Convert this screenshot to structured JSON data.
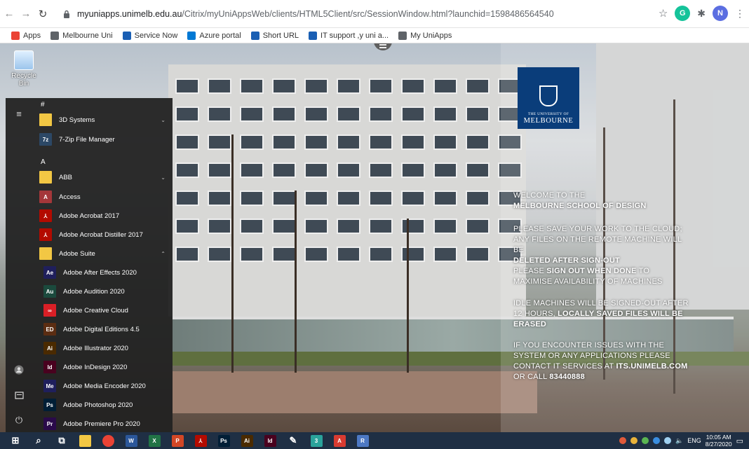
{
  "browser": {
    "url_host": "myuniapps.unimelb.edu.au",
    "url_path": "/Citrix/myUniAppsWeb/clients/HTML5Client/src/SessionWindow.html?launchid=1598486564540",
    "profile_initial": "N",
    "extension_initial": "G"
  },
  "bookmarks": [
    {
      "label": "Apps",
      "icon": "grid-icon",
      "color": "#ea4335"
    },
    {
      "label": "Melbourne Uni",
      "icon": "folder-icon",
      "color": "#5f6368"
    },
    {
      "label": "Service Now",
      "icon": "servicenow-icon",
      "color": "#1a5fb4"
    },
    {
      "label": "Azure portal",
      "icon": "azure-icon",
      "color": "#0078d4"
    },
    {
      "label": "Short URL",
      "icon": "shorturl-icon",
      "color": "#1a5fb4"
    },
    {
      "label": "IT support ,y uni a...",
      "icon": "itsupport-icon",
      "color": "#1a5fb4"
    },
    {
      "label": "My UniApps",
      "icon": "globe-icon",
      "color": "#5f6368"
    }
  ],
  "desktop": {
    "recycle_bin_label": "Recycle Bin"
  },
  "logo": {
    "top_line": "THE UNIVERSITY OF",
    "name": "MELBOURNE",
    "color": "#0a3d7a"
  },
  "messages": {
    "m1a": "WELCOME TO THE",
    "m1b": "MELBOURNE SCHOOL OF DESIGN",
    "m2a": "PLEASE SAVE YOUR WORK TO THE CLOUD; ANY FILES ON THE REMOTE MACHINE WILL BE",
    "m2b": "DELETED AFTER SIGN-OUT",
    "m3a": "PLEASE",
    "m3b": "SIGN OUT WHEN DONE",
    "m3c": "TO MAXIMISE AVAILABILITY OF MACHINES",
    "m4a": "IDLE MACHINES WILL BE SIGNED-OUT AFTER 12 HOURS,",
    "m4b": "LOCALLY SAVED FILES WILL BE ERASED",
    "m5a": "IF YOU ENCOUNTER ISSUES WITH THE SYSTEM OR ANY APPLICATIONS PLEASE CONTACT IT SERVICES AT",
    "m5b": "ITS.UNIMELB.COM",
    "m5c": "OR CALL",
    "m5d": "83440888"
  },
  "start_menu": {
    "letters": {
      "hash": "#",
      "a": "A"
    },
    "items": [
      {
        "label": "3D Systems",
        "icon": "folder-icon",
        "glyph": "",
        "color": "#f2c744",
        "chevron": "down"
      },
      {
        "label": "7-Zip File Manager",
        "icon": "7zip-icon",
        "glyph": "7z",
        "color": "#2c4866",
        "chevron": ""
      },
      {
        "label": "ABB",
        "icon": "folder-icon",
        "glyph": "",
        "color": "#f2c744",
        "chevron": "down"
      },
      {
        "label": "Access",
        "icon": "access-icon",
        "glyph": "A",
        "color": "#a4373a",
        "chevron": ""
      },
      {
        "label": "Adobe Acrobat 2017",
        "icon": "acrobat-icon",
        "glyph": "⅄",
        "color": "#b30b00",
        "chevron": ""
      },
      {
        "label": "Adobe Acrobat Distiller 2017",
        "icon": "distiller-icon",
        "glyph": "⅄",
        "color": "#b30b00",
        "chevron": ""
      },
      {
        "label": "Adobe Suite",
        "icon": "folder-icon",
        "glyph": "",
        "color": "#f2c744",
        "chevron": "up"
      }
    ],
    "sub_items": [
      {
        "label": "Adobe After Effects 2020",
        "icon": "after-effects-icon",
        "glyph": "Ae",
        "color": "#1f1f5c"
      },
      {
        "label": "Adobe Audition 2020",
        "icon": "audition-icon",
        "glyph": "Au",
        "color": "#1b4a3d"
      },
      {
        "label": "Adobe Creative Cloud",
        "icon": "creative-cloud-icon",
        "glyph": "∞",
        "color": "#da1f26"
      },
      {
        "label": "Adobe Digital Editions 4.5",
        "icon": "digital-editions-icon",
        "glyph": "ED",
        "color": "#5b2d12"
      },
      {
        "label": "Adobe Illustrator 2020",
        "icon": "illustrator-icon",
        "glyph": "Ai",
        "color": "#4a2a00"
      },
      {
        "label": "Adobe InDesign 2020",
        "icon": "indesign-icon",
        "glyph": "Id",
        "color": "#49021f"
      },
      {
        "label": "Adobe Media Encoder 2020",
        "icon": "media-encoder-icon",
        "glyph": "Me",
        "color": "#1f1f5c"
      },
      {
        "label": "Adobe Photoshop 2020",
        "icon": "photoshop-icon",
        "glyph": "Ps",
        "color": "#001e36"
      },
      {
        "label": "Adobe Premiere Pro 2020",
        "icon": "premiere-icon",
        "glyph": "Pr",
        "color": "#2a0a4a"
      }
    ]
  },
  "taskbar": {
    "apps": [
      {
        "name": "start-icon",
        "glyph": "⊞",
        "color": "#1f2f44"
      },
      {
        "name": "search-icon",
        "glyph": "⌕",
        "color": "#1f2f44"
      },
      {
        "name": "task-view-icon",
        "glyph": "⧉",
        "color": "#1f2f44"
      },
      {
        "name": "file-explorer-icon",
        "glyph": "",
        "color": "#f2c744"
      },
      {
        "name": "chrome-icon",
        "glyph": "",
        "color": "#ea4335"
      },
      {
        "name": "word-icon",
        "glyph": "W",
        "color": "#2b579a"
      },
      {
        "name": "excel-icon",
        "glyph": "X",
        "color": "#217346"
      },
      {
        "name": "powerpoint-icon",
        "glyph": "P",
        "color": "#d24726"
      },
      {
        "name": "acrobat-icon",
        "glyph": "⅄",
        "color": "#b30b00"
      },
      {
        "name": "photoshop-icon",
        "glyph": "Ps",
        "color": "#001e36"
      },
      {
        "name": "illustrator-icon",
        "glyph": "Ai",
        "color": "#4a2a00"
      },
      {
        "name": "indesign-icon",
        "glyph": "Id",
        "color": "#49021f"
      },
      {
        "name": "inkscape-icon",
        "glyph": "✎",
        "color": "#1f2f44"
      },
      {
        "name": "app3-icon",
        "glyph": "3",
        "color": "#2aa39b"
      },
      {
        "name": "autodesk-icon",
        "glyph": "A",
        "color": "#d83b31"
      },
      {
        "name": "rstudio-icon",
        "glyph": "R",
        "color": "#4d79c4"
      }
    ],
    "language": "ENG",
    "time": "10:05 AM",
    "date": "8/27/2020"
  }
}
